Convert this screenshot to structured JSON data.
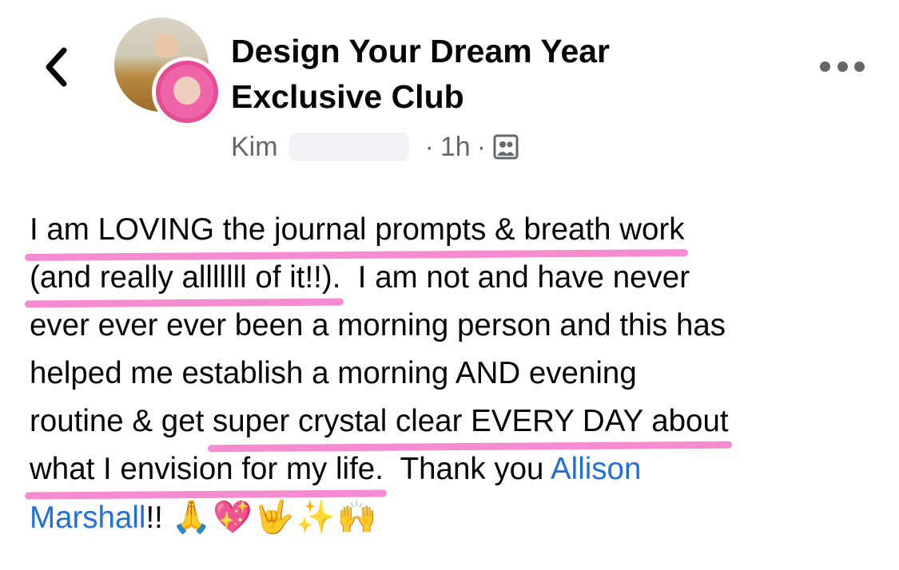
{
  "header": {
    "back_icon": "chevron-left-icon",
    "group_name_line1": "Design Your Dream Year",
    "group_name_line2": "Exclusive Club",
    "author_first_name": "Kim",
    "timestamp": "1h",
    "separator": "·",
    "audience_icon": "group-members-icon",
    "more_icon": "more-horizontal-icon"
  },
  "post": {
    "line1_highlight": "I am LOVING the journal prompts & breath work",
    "line2_highlight": "(and really alllllll of it!!).",
    "line2_rest": "  I am not and have never",
    "line3": "ever ever ever been a morning person and this has",
    "line4": "helped me establish a morning AND evening",
    "line5_plain": "routine & get ",
    "line5_highlight": "super crystal clear EVERY DAY about",
    "line6_highlight": "what I envision for my life.",
    "line6_plain": "  Thank you ",
    "mention_first": "Allison",
    "mention_last": "Marshall",
    "line7_after_mention": "!! ",
    "emojis": "🙏💖🤟✨🙌"
  },
  "colors": {
    "highlight": "#f58bd0",
    "link": "#216fdb",
    "meta": "#65676b"
  }
}
